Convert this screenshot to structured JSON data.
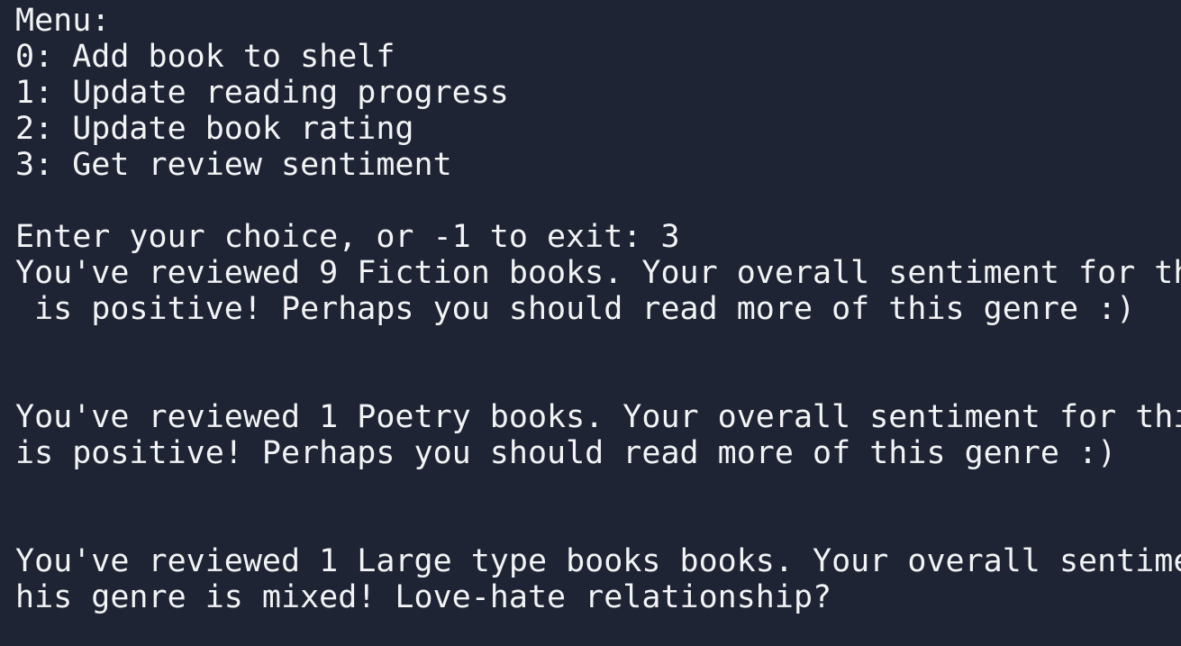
{
  "terminal": {
    "menu_title": "Menu:",
    "options": [
      "0: Add book to shelf",
      "1: Update reading progress",
      "2: Update book rating",
      "3: Get review sentiment"
    ],
    "prompt_line": "Enter your choice, or -1 to exit: 3",
    "output": [
      {
        "line1": "You've reviewed 9 Fiction books. Your overall sentiment for th",
        "line2": " is positive! Perhaps you should read more of this genre :)"
      },
      {
        "line1": "You've reviewed 1 Poetry books. Your overall sentiment for thi",
        "line2": "is positive! Perhaps you should read more of this genre :)"
      },
      {
        "line1": "You've reviewed 1 Large type books books. Your overall sentime",
        "line2": "his genre is mixed! Love-hate relationship?"
      }
    ]
  }
}
